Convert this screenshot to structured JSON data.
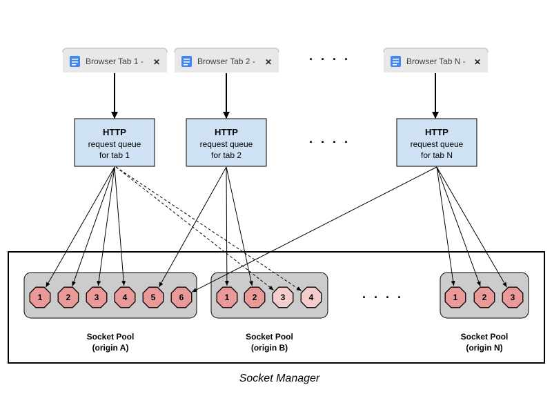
{
  "tabs": [
    {
      "label": "Browser Tab 1 -",
      "icon": "document-icon",
      "close": "✕"
    },
    {
      "label": "Browser Tab 2 -",
      "icon": "document-icon",
      "close": "✕"
    },
    {
      "label": "Browser Tab N -",
      "icon": "document-icon",
      "close": "✕"
    }
  ],
  "queues": [
    {
      "title": "HTTP",
      "line1": "request queue",
      "line2": "for tab 1"
    },
    {
      "title": "HTTP",
      "line1": "request queue",
      "line2": "for tab 2"
    },
    {
      "title": "HTTP",
      "line1": "request queue",
      "line2": "for tab N"
    }
  ],
  "ellipsis": "· · · ·",
  "pools": [
    {
      "label1": "Socket Pool",
      "label2": "(origin A)",
      "sockets": [
        {
          "n": "1",
          "state": "active"
        },
        {
          "n": "2",
          "state": "active"
        },
        {
          "n": "3",
          "state": "active"
        },
        {
          "n": "4",
          "state": "active"
        },
        {
          "n": "5",
          "state": "active"
        },
        {
          "n": "6",
          "state": "active"
        }
      ]
    },
    {
      "label1": "Socket Pool",
      "label2": "(origin B)",
      "sockets": [
        {
          "n": "1",
          "state": "active"
        },
        {
          "n": "2",
          "state": "active"
        },
        {
          "n": "3",
          "state": "pending"
        },
        {
          "n": "4",
          "state": "pending"
        }
      ]
    },
    {
      "label1": "Socket Pool",
      "label2": "(origin N)",
      "sockets": [
        {
          "n": "1",
          "state": "active"
        },
        {
          "n": "2",
          "state": "active"
        },
        {
          "n": "3",
          "state": "active"
        }
      ]
    }
  ],
  "manager_label": "Socket Manager",
  "connections": [
    {
      "queue": 0,
      "pool": 0,
      "socket": 0,
      "dashed": false
    },
    {
      "queue": 0,
      "pool": 0,
      "socket": 1,
      "dashed": false
    },
    {
      "queue": 0,
      "pool": 0,
      "socket": 2,
      "dashed": false
    },
    {
      "queue": 0,
      "pool": 0,
      "socket": 3,
      "dashed": false
    },
    {
      "queue": 0,
      "pool": 1,
      "socket": 2,
      "dashed": true
    },
    {
      "queue": 0,
      "pool": 1,
      "socket": 3,
      "dashed": true
    },
    {
      "queue": 1,
      "pool": 0,
      "socket": 4,
      "dashed": false
    },
    {
      "queue": 1,
      "pool": 1,
      "socket": 0,
      "dashed": false
    },
    {
      "queue": 1,
      "pool": 1,
      "socket": 1,
      "dashed": false
    },
    {
      "queue": 2,
      "pool": 0,
      "socket": 5,
      "dashed": false
    },
    {
      "queue": 2,
      "pool": 2,
      "socket": 0,
      "dashed": false
    },
    {
      "queue": 2,
      "pool": 2,
      "socket": 1,
      "dashed": false
    },
    {
      "queue": 2,
      "pool": 2,
      "socket": 2,
      "dashed": false
    }
  ],
  "colors": {
    "tab_bg": "#e8e8e8",
    "doc_icon": "#4285f4",
    "queue_fill": "#cfe2f3",
    "pool_fill": "#cccccc",
    "socket_active": "#ea9999",
    "socket_pending": "#f4cccc"
  }
}
